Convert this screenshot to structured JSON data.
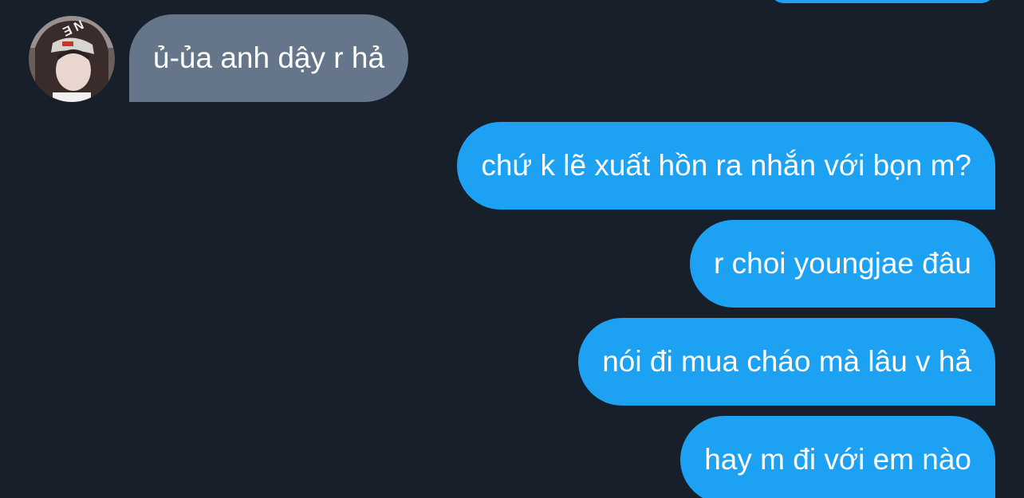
{
  "conversation": {
    "messages": [
      {
        "sender": "other",
        "text": "ủ-ủa anh dậy r hả"
      },
      {
        "sender": "me",
        "text": "chứ k lẽ xuất hồn ra nhắn với bọn m?"
      },
      {
        "sender": "me",
        "text": "r choi youngjae đâu"
      },
      {
        "sender": "me",
        "text": "nói đi mua cháo mà lâu v hả"
      },
      {
        "sender": "me",
        "text": "hay m đi với em nào"
      }
    ]
  },
  "avatar": {
    "icon": "user-avatar-photo"
  },
  "colors": {
    "background": "#17202a",
    "incoming_bubble": "#66768a",
    "outgoing_bubble": "#1da1f2",
    "text": "#ffffff"
  }
}
